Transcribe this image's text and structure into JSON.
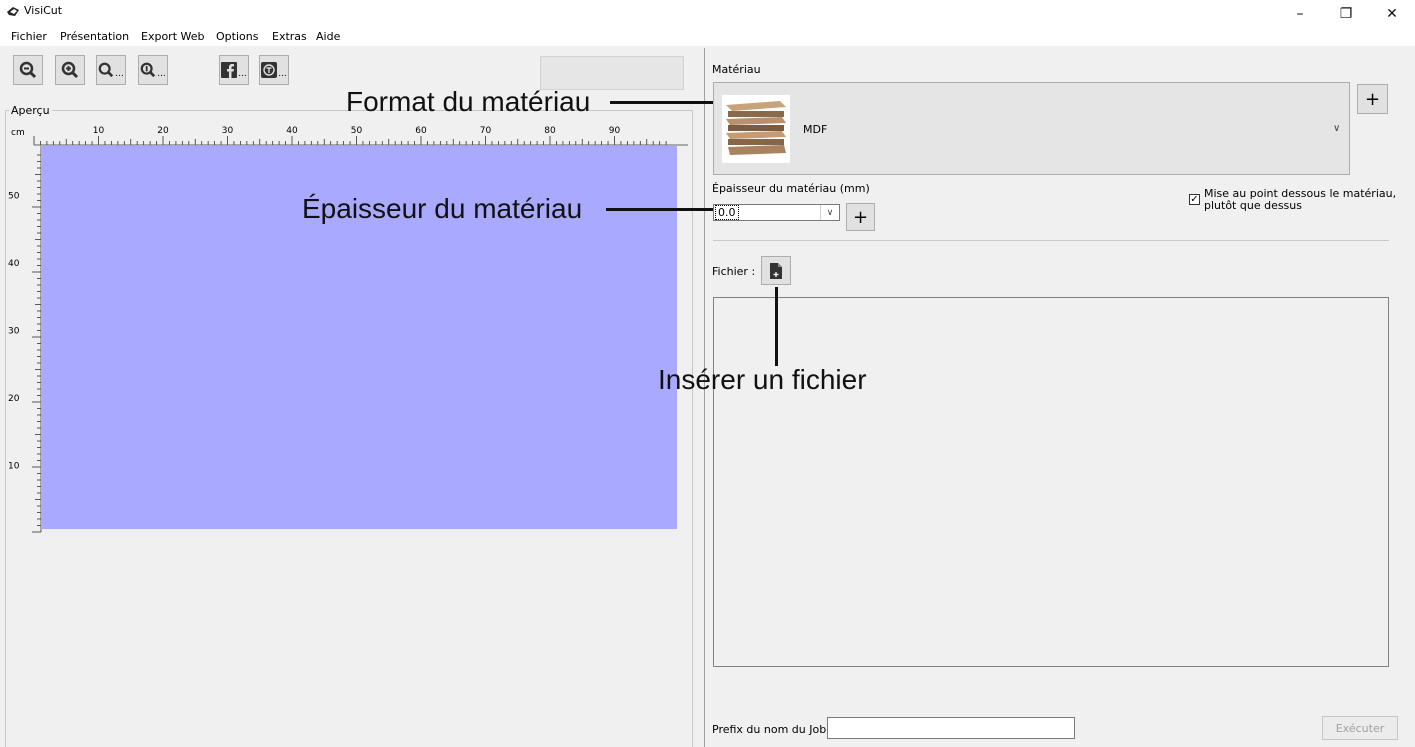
{
  "window": {
    "title": "VisiCut",
    "minimize_glyph": "–",
    "restore_glyph": "❐",
    "close_glyph": "✕"
  },
  "menu": [
    "Fichier",
    "Présentation",
    "Export Web",
    "Options",
    "Extras",
    "Aide"
  ],
  "toolbar": {
    "ellipsis": "..."
  },
  "preview": {
    "label": "Aperçu",
    "unit": "cm",
    "x_ticks": [
      "10",
      "20",
      "30",
      "40",
      "50",
      "60",
      "70",
      "80",
      "90"
    ],
    "y_ticks": [
      "50",
      "40",
      "30",
      "20",
      "10"
    ],
    "area_color": "#a9a9ff"
  },
  "material": {
    "label": "Matériau",
    "selected": "MDF",
    "add_glyph": "+"
  },
  "thickness": {
    "label": "Épaisseur du matériau (mm)",
    "value": "0.0",
    "add_glyph": "+"
  },
  "focus": {
    "checked_glyph": "✓",
    "text": "Mise au point dessous le matériau, plutôt que dessus"
  },
  "file": {
    "label": "Fichier :"
  },
  "job": {
    "prefix_label": "Prefix du nom du Job:",
    "prefix_value": "",
    "execute_label": "Exécuter"
  },
  "annotations": {
    "material_format": "Format du matériau",
    "material_thickness": "Épaisseur du matériau",
    "insert_file": "Insérer un fichier"
  }
}
